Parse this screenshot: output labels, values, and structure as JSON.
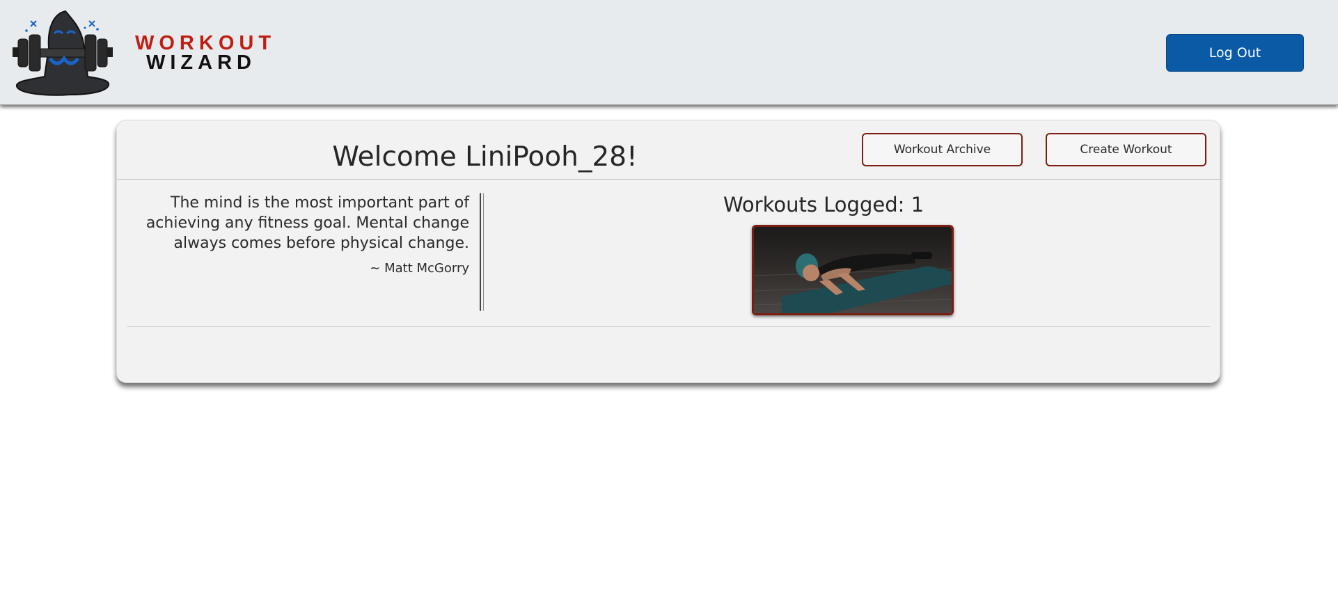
{
  "header": {
    "logo": {
      "line1": "WORKOUT",
      "line2": "WIZARD"
    },
    "logout_label": "Log Out"
  },
  "dashboard": {
    "welcome": "Welcome LiniPooh_28!",
    "archive_label": "Workout Archive",
    "create_label": "Create Workout",
    "quote": {
      "text": "The mind is the most important part of achieving any fitness goal. Mental change always comes before physical change.",
      "author": "~ Matt McGorry"
    },
    "workouts_logged": "Workouts Logged: 1"
  },
  "colors": {
    "brand_red": "#c01e10",
    "accent_blue": "#0a5aa6",
    "button_border": "#7a1e12"
  }
}
